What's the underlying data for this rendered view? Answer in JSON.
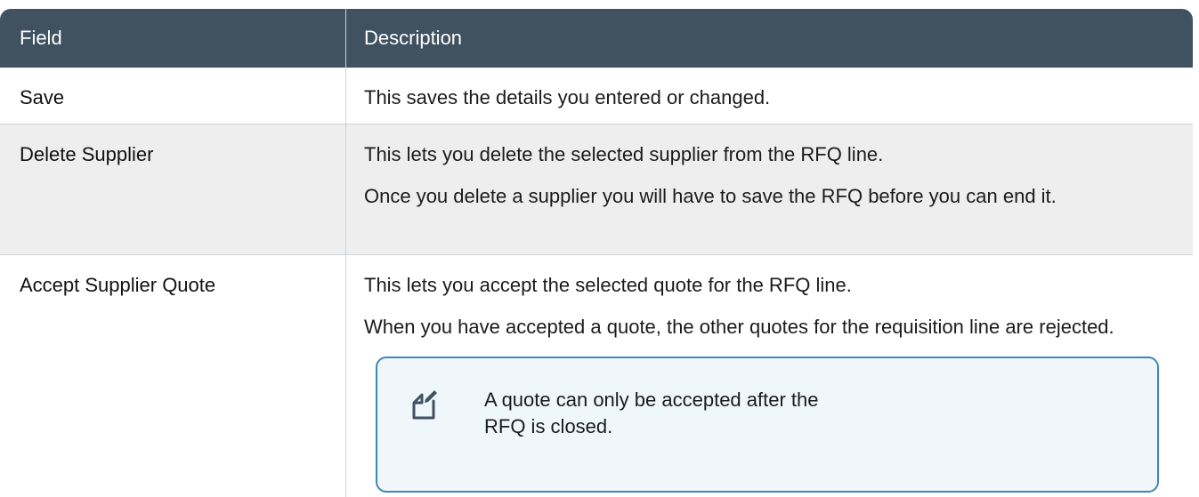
{
  "table": {
    "headers": [
      "Field",
      "Description"
    ],
    "rows": [
      {
        "field": "Save",
        "desc": [
          "This saves the details you entered or changed."
        ]
      },
      {
        "field": "Delete Supplier",
        "desc": [
          "This lets you delete the selected supplier from the RFQ line.",
          "Once you delete a supplier you will have to save the RFQ before you can end it."
        ]
      },
      {
        "field": "Accept Supplier Quote",
        "desc": [
          "This lets you accept the selected quote for the RFQ line.",
          "When you have accepted a quote, the other quotes for the requisition line are rejected."
        ]
      }
    ]
  },
  "note": {
    "icon": "note-edit-icon",
    "text": "A quote can only be accepted after the RFQ is closed."
  },
  "colors": {
    "header_bg": "#405160",
    "row_alt_bg": "#eeeeee",
    "note_border": "#3f86b4",
    "note_bg": "#f0f7fb"
  }
}
